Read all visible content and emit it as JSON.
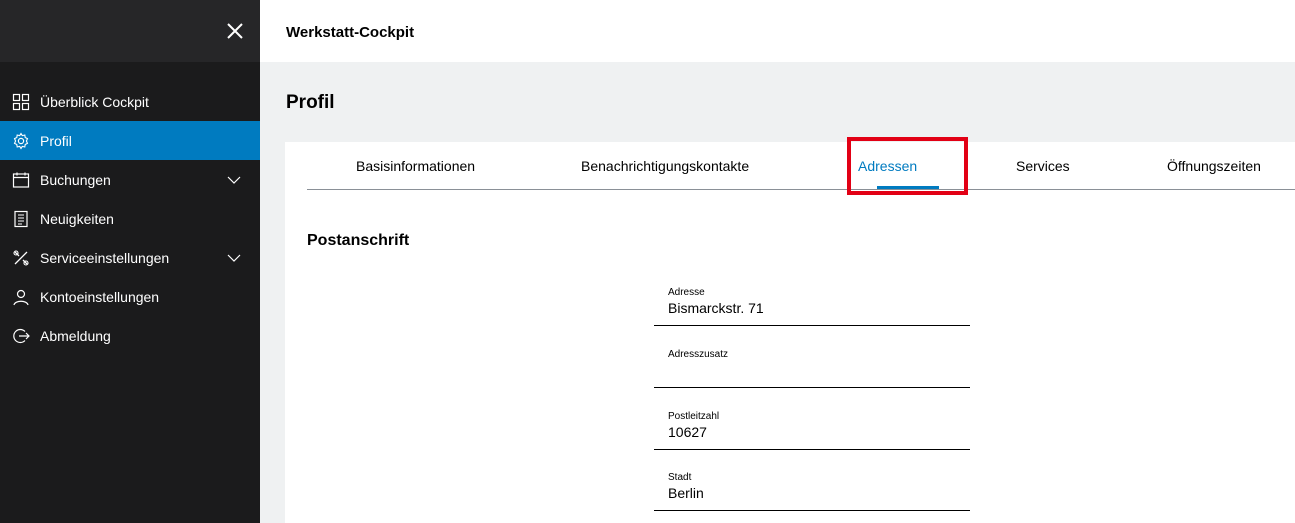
{
  "sidebar": {
    "close_icon": "close-icon",
    "items": [
      {
        "label": "Überblick Cockpit",
        "icon": "grid-icon"
      },
      {
        "label": "Profil",
        "icon": "gear-icon",
        "active": true
      },
      {
        "label": "Buchungen",
        "icon": "calendar-icon",
        "expandable": true
      },
      {
        "label": "Neuigkeiten",
        "icon": "document-icon"
      },
      {
        "label": "Serviceeinstellungen",
        "icon": "tools-icon",
        "expandable": true
      },
      {
        "label": "Kontoeinstellungen",
        "icon": "user-icon"
      },
      {
        "label": "Abmeldung",
        "icon": "logout-icon"
      }
    ]
  },
  "header": {
    "app_title": "Werkstatt-Cockpit"
  },
  "page": {
    "title": "Profil"
  },
  "tabs": [
    {
      "label": "Basisinformationen"
    },
    {
      "label": "Benachrichtigungskontakte"
    },
    {
      "label": "Adressen",
      "active": true
    },
    {
      "label": "Services"
    },
    {
      "label": "Öffnungszeiten"
    }
  ],
  "section": {
    "title": "Postanschrift"
  },
  "fields": [
    {
      "label": "Adresse",
      "value": "Bismarckstr. 71"
    },
    {
      "label": "Adresszusatz",
      "value": ""
    },
    {
      "label": "Postleitzahl",
      "value": "10627"
    },
    {
      "label": "Stadt",
      "value": "Berlin"
    }
  ],
  "colors": {
    "sidebar_bg": "#1b1b1c",
    "active_nav": "#007bc0",
    "accent": "#007bc0",
    "highlight": "#e20015",
    "page_bg": "#eff1f2"
  }
}
